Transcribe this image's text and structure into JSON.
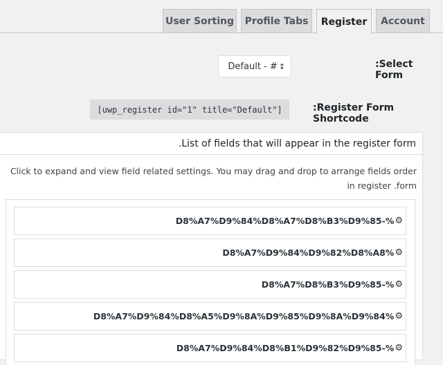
{
  "tabs": [
    {
      "label": "User Sorting"
    },
    {
      "label": "Profile Tabs"
    },
    {
      "label": "Register"
    },
    {
      "label": "Account"
    }
  ],
  "select_form": {
    "label": ":Select Form",
    "value": "Default - #",
    "arrow": "↕"
  },
  "shortcode": {
    "label": ":Register Form Shortcode",
    "value": "[uwp_register id=\"1\" title=\"Default\"]"
  },
  "fields_panel": {
    "title": ".List of fields that will appear in the register form",
    "description": "Click to expand and view field related settings. You may drag and drop to arrange fields order in register .form",
    "items": [
      {
        "label": "D8%A7%D9%84%D8%A7%D8%B3%D9%85-%"
      },
      {
        "label": "D8%A7%D9%84%D9%82%D8%A8%"
      },
      {
        "label": "D8%A7%D8%B3%D9%85-%"
      },
      {
        "label": "D8%A7%D9%84%D8%A5%D9%8A%D9%85%D9%8A%D9%84%"
      },
      {
        "label": "D8%A7%D9%84%D8%B1%D9%82%D9%85-%"
      }
    ]
  }
}
